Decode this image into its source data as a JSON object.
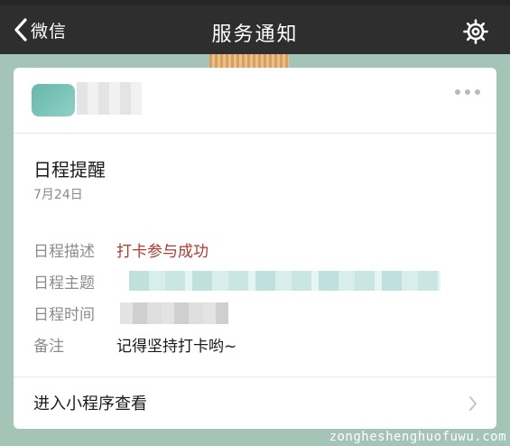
{
  "navbar": {
    "back_label": "微信",
    "title": "服务通知",
    "icons": {
      "back": "chevron-left-icon",
      "settings": "gear-icon"
    }
  },
  "card": {
    "title": "日程提醒",
    "date": "7月24日",
    "rows": [
      {
        "label": "日程描述",
        "value": "打卡参与成功",
        "value_color": "#b23a2f"
      },
      {
        "label": "日程主题",
        "value": ""
      },
      {
        "label": "日程时间",
        "value": ""
      },
      {
        "label": "备注",
        "value": "记得坚持打卡哟~"
      }
    ],
    "footer_label": "进入小程序查看",
    "icons": {
      "more": "more-dots-icon",
      "footer": "chevron-right-icon"
    }
  },
  "watermark": "zongheshenghuofuwu.com",
  "colors": {
    "navbar": "#2e2e2e",
    "background": "#a4c4b8",
    "card": "#ffffff",
    "accent_red": "#b23a2f"
  }
}
